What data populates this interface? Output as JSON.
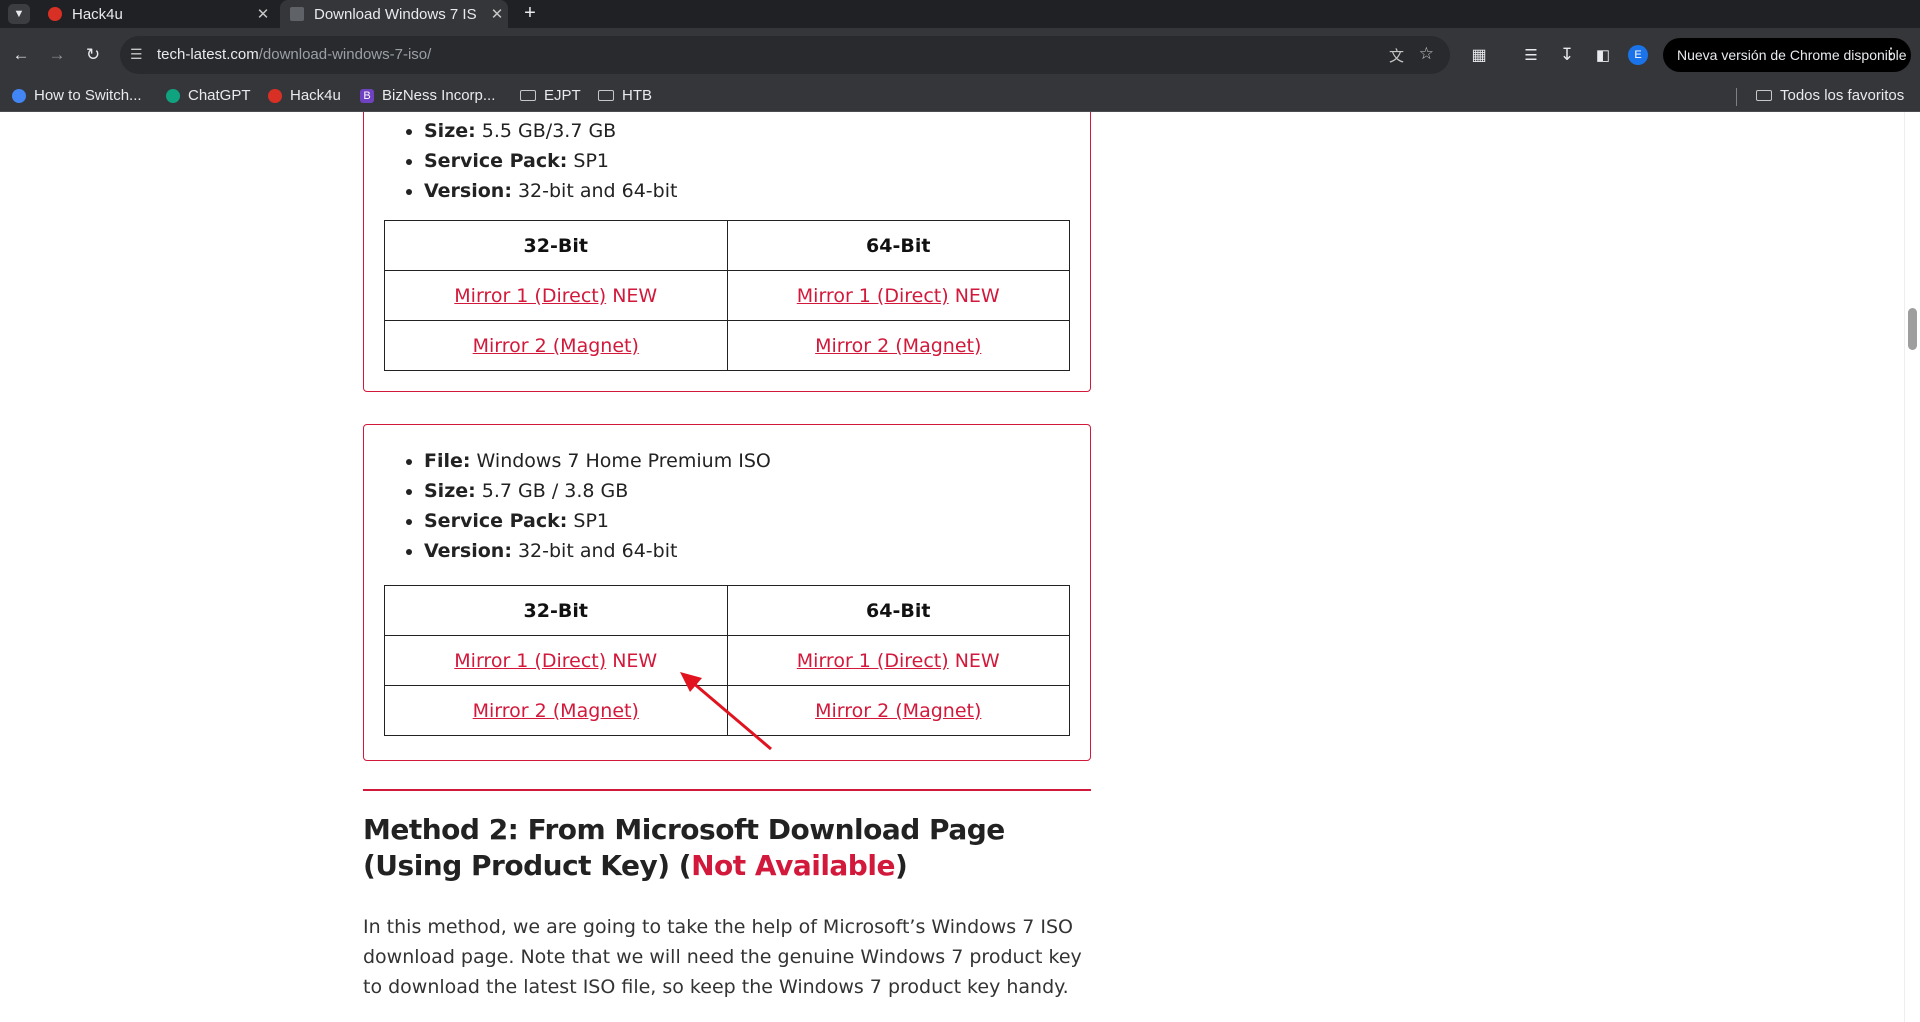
{
  "browser": {
    "tabs": [
      {
        "title": "Hack4u",
        "active": false
      },
      {
        "title": "Download Windows 7 IS",
        "active": true
      }
    ],
    "url_host": "tech-latest.com",
    "url_path": "/download-windows-7-iso/",
    "update_button": "Nueva versión de Chrome disponible",
    "profile_initial": "E",
    "bookmarks": [
      "How to Switch...",
      "ChatGPT",
      "Hack4u",
      "BizNess Incorp...",
      "EJPT",
      "HTB"
    ],
    "all_bookmarks": "Todos los favoritos",
    "icons": {
      "back": "arrow-left-icon",
      "forward": "arrow-right-icon",
      "reload": "reload-icon"
    }
  },
  "card1": {
    "size_label": "Size:",
    "size_value": " 5.5 GB/3.7 GB",
    "sp_label": "Service Pack:",
    "sp_value": " SP1",
    "ver_label": "Version:",
    "ver_value": " 32-bit and 64-bit",
    "col32": "32-Bit",
    "col64": "64-Bit",
    "mirror1": "Mirror 1 (Direct)",
    "new_tag": " NEW",
    "mirror2": "Mirror 2 (Magnet)"
  },
  "card2": {
    "file_label": "File:",
    "file_value": " Windows 7 Home Premium ISO",
    "size_label": "Size:",
    "size_value": " 5.7 GB / 3.8 GB",
    "sp_label": "Service Pack:",
    "sp_value": " SP1",
    "ver_label": "Version:",
    "ver_value": " 32-bit and 64-bit",
    "col32": "32-Bit",
    "col64": "64-Bit",
    "mirror1": "Mirror 1 (Direct)",
    "new_tag": " NEW",
    "mirror2": "Mirror 2 (Magnet)"
  },
  "method2": {
    "title_main": "Method 2: From Microsoft Download Page (Using Product Key) (",
    "title_red": "Not Available",
    "title_end": ")",
    "paragraph": "In this method, we are going to take the help of Microsoft’s Windows 7 ISO download page. Note that we will need the genuine Windows 7 product key to download the latest ISO file, so keep the Windows 7 product key handy."
  },
  "colors": {
    "accent": "#d2193b",
    "chrome_dark": "#202124",
    "chrome_toolbar": "#35363a"
  }
}
